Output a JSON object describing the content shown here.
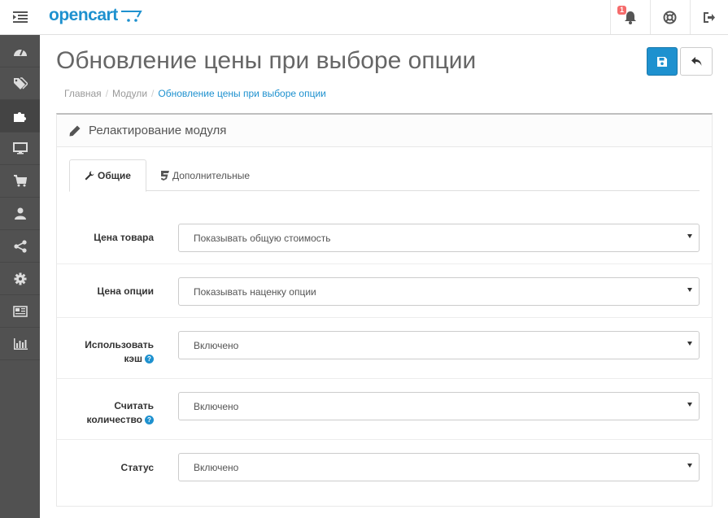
{
  "header": {
    "logo_text": "opencart",
    "notification_count": "1"
  },
  "page": {
    "title": "Обновление цены при выборе опции"
  },
  "breadcrumb": {
    "home": "Главная",
    "modules": "Модули",
    "current": "Обновление цены при выборе опции"
  },
  "panel": {
    "title": "Релактирование модуля"
  },
  "tabs": {
    "general": "Общие",
    "additional": "Дополнительные"
  },
  "form": {
    "price_label": "Цена товара",
    "price_value": "Показывать общую стоимость",
    "option_price_label": "Цена опции",
    "option_price_value": "Показывать наценку опции",
    "cache_label_1": "Использовать",
    "cache_label_2": "кэш",
    "cache_value": "Включено",
    "count_label_1": "Считать",
    "count_label_2": "количество",
    "count_value": "Включено",
    "status_label": "Статус",
    "status_value": "Включено",
    "help_glyph": "?"
  },
  "colors": {
    "accent": "#1e91cf",
    "sidebar": "#515151",
    "badge": "#f56b6b"
  }
}
